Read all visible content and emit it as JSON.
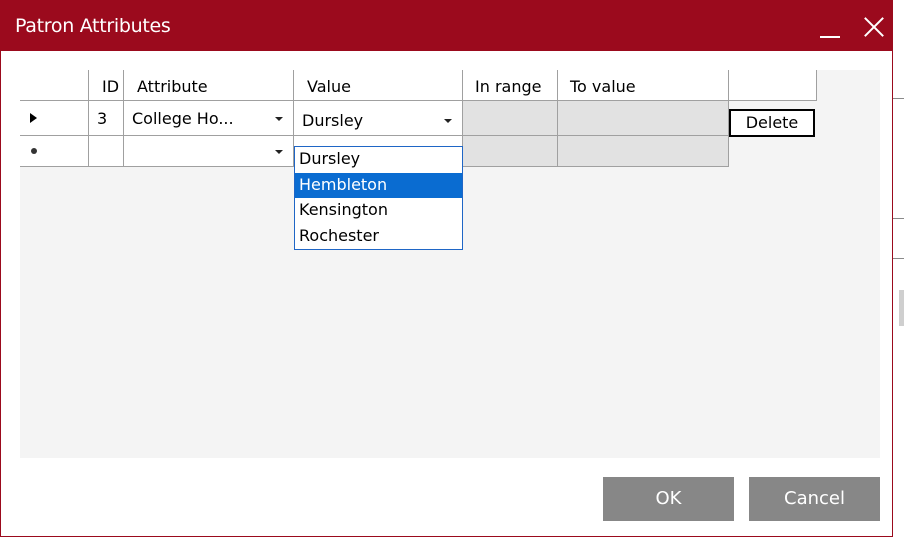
{
  "window": {
    "title": "Patron Attributes"
  },
  "grid": {
    "columns": [
      "ID",
      "Attribute",
      "Value",
      "In range",
      "To value"
    ],
    "rows": [
      {
        "id": "3",
        "attribute": "College Ho...",
        "value": "Dursley",
        "action": "Delete"
      },
      {
        "id": "",
        "attribute": "",
        "value": "Dursley"
      }
    ]
  },
  "dropdown": {
    "options": [
      "Dursley",
      "Hembleton",
      "Kensington",
      "Rochester"
    ],
    "highlighted": "Hembleton"
  },
  "buttons": {
    "ok": "OK",
    "cancel": "Cancel"
  },
  "colors": {
    "titlebar": "#9b0a1d",
    "selection": "#0a6cd1",
    "button": "#878787"
  }
}
